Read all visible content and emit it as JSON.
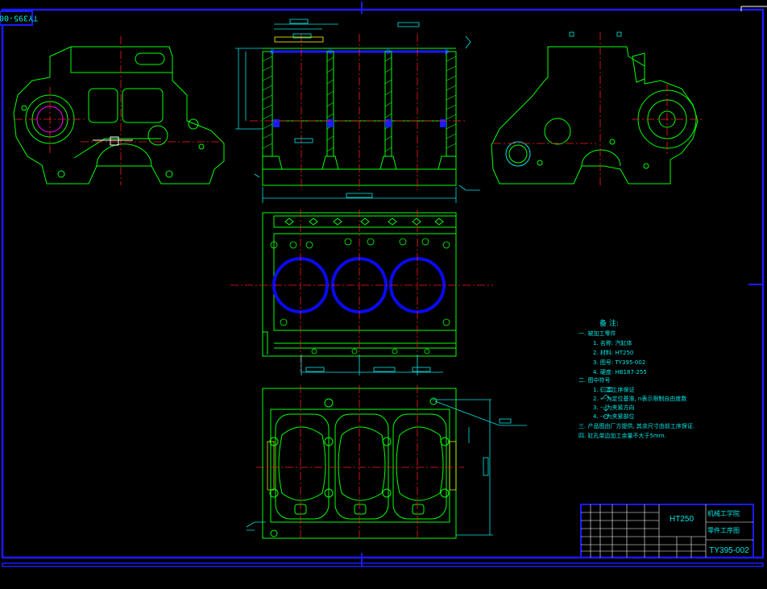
{
  "drawing": {
    "corner_tag": "TY395-002",
    "colors": {
      "background": "#000000",
      "frame": "#1a1aff",
      "outline": "#00ff00",
      "center_line": "#ff1a1a",
      "dimension": "#00e5e5",
      "bore": "#0a0aee",
      "yellow_line": "#ffff00",
      "magenta": "#ff00ff",
      "white": "#ffffff"
    }
  },
  "notes": {
    "title": "备 注:",
    "lines": [
      "一. 被加工零件",
      "1. 名称: 汽缸体",
      "2. 材料: HT250",
      "3. 图号: TY395-002",
      "4. 硬度: HB187-255",
      "二. 图中符号",
      "1. ---本工序保证",
      "2. ---为定位基准, n表示限制自由度数",
      "3. ---为夹紧方向",
      "4. ---为夹紧部位",
      "三. 产品图由厂方提供, 其余尺寸由前工序保证.",
      "四. 缸孔单边加工余量不大于5mm."
    ]
  },
  "title_block": {
    "material": "HT250",
    "school": "机械工学院",
    "drawing_name": "零件工序图",
    "drawing_number": "TY395-002"
  }
}
